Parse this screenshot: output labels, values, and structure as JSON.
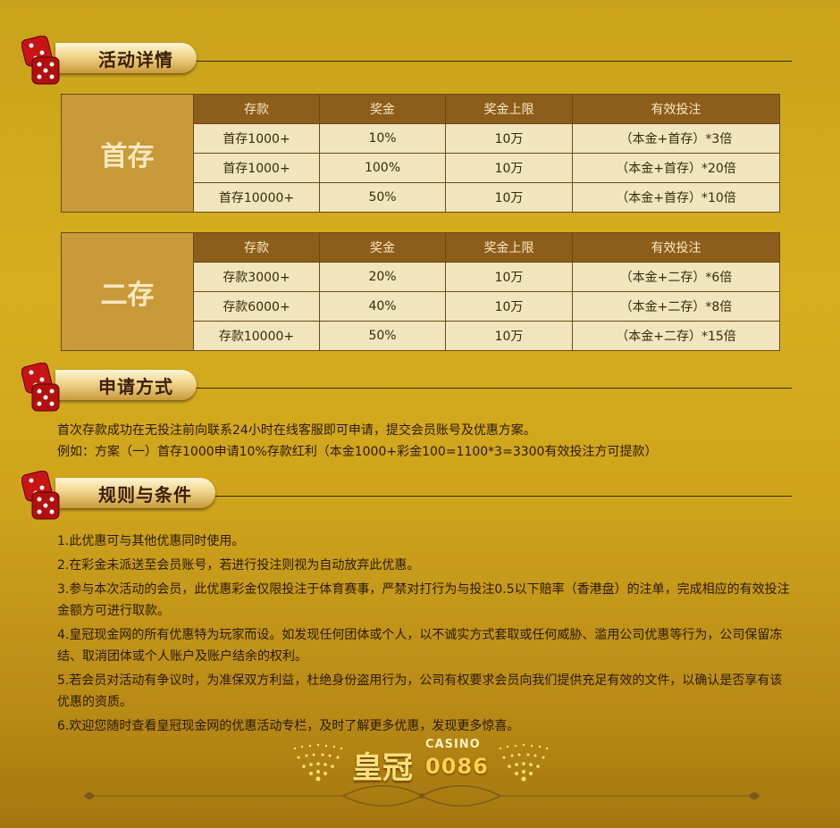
{
  "sections": {
    "details_title": "活动详情",
    "apply_title": "申请方式",
    "rules_title": "规则与条件"
  },
  "table1": {
    "side_label": "首存",
    "headers": [
      "存款",
      "奖金",
      "奖金上限",
      "有效投注"
    ],
    "rows": [
      [
        "首存1000+",
        "10%",
        "10万",
        "（本金+首存）*3倍"
      ],
      [
        "首存1000+",
        "100%",
        "10万",
        "（本金+首存）*20倍"
      ],
      [
        "首存10000+",
        "50%",
        "10万",
        "（本金+首存）*10倍"
      ]
    ]
  },
  "table2": {
    "side_label": "二存",
    "headers": [
      "存款",
      "奖金",
      "奖金上限",
      "有效投注"
    ],
    "rows": [
      [
        "存款3000+",
        "20%",
        "10万",
        "（本金+二存）*6倍"
      ],
      [
        "存款6000+",
        "40%",
        "10万",
        "（本金+二存）*8倍"
      ],
      [
        "存款10000+",
        "50%",
        "10万",
        "（本金+二存）*15倍"
      ]
    ]
  },
  "apply": {
    "line1": "首次存款成功在无投注前向联系24小时在线客服即可申请，提交会员账号及优惠方案。",
    "line2": "例如：方案（一）首存1000申请10%存款红利（本金1000+彩金100=1100*3=3300有效投注方可提款）"
  },
  "rules": [
    "1.此优惠可与其他优惠同时使用。",
    "2.在彩金未派送至会员账号，若进行投注则视为自动放弃此优惠。",
    "3.参与本次活动的会员，此优惠彩金仅限投注于体育赛事，严禁对打行为与投注0.5以下赔率（香港盘）的注单，完成相应的有效投注金额方可进行取款。",
    "4.皇冠现金网的所有优惠特为玩家而设。如发现任何团体或个人，以不诚实方式套取或任何威胁、滥用公司优惠等行为，公司保留冻结、取消团体或个人账户及账户结余的权利。",
    "5.若会员对活动有争议时，为准保双方利益，杜绝身份盗用行为，公司有权要求会员向我们提供充足有效的文件，以确认是否享有该优惠的资质。",
    "6.欢迎您随时查看皇冠现金网的优惠活动专栏，及时了解更多优惠，发现更多惊喜。"
  ],
  "logo": {
    "main": "皇冠",
    "casino": "CASINO",
    "number": "0086"
  },
  "colors": {
    "table_header": "#8c5d1b",
    "table_cell": "#f2e4bd",
    "table_side": "#c89a3a",
    "dice": "#c81414"
  }
}
